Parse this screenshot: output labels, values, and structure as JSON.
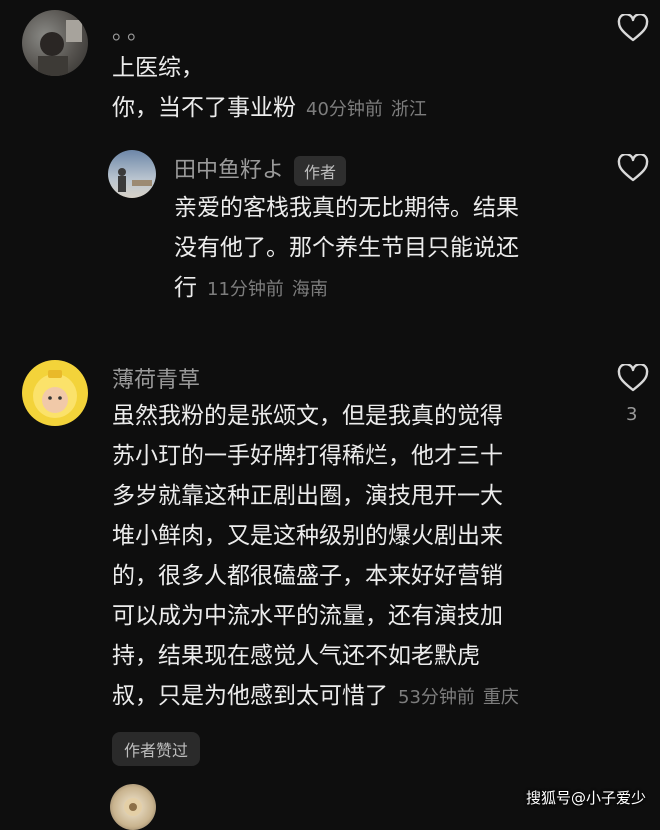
{
  "comments": [
    {
      "username": "。。",
      "lines": [
        "上医综，",
        "你，当不了事业粉"
      ],
      "time": "40分钟前",
      "location": "浙江"
    },
    {
      "username": "田中鱼籽よ",
      "badge": "作者",
      "lines": [
        "亲爱的客栈我真的无比期待。结果",
        "没有他了。那个养生节目只能说还",
        "行"
      ],
      "time": "11分钟前",
      "location": "海南"
    },
    {
      "username": "薄荷青草",
      "lines": [
        "虽然我粉的是张颂文，但是我真的觉得",
        "苏小玎的一手好牌打得稀烂，他才三十",
        "多岁就靠这种正剧出圈，演技甩开一大",
        "堆小鲜肉，又是这种级别的爆火剧出来",
        "的，很多人都很磕盛子，本来好好营销",
        "可以成为中流水平的流量，还有演技加",
        "持，结果现在感觉人气还不如老默虎",
        "叔，只是为他感到太可惜了"
      ],
      "time": "53分钟前",
      "location": "重庆",
      "like_count": "3",
      "author_liked": "作者赞过"
    }
  ],
  "watermark": "搜狐号@小子爱少",
  "colors": {
    "background": "#0e0e0e",
    "text": "#ececec",
    "meta": "#7d7d7d"
  }
}
